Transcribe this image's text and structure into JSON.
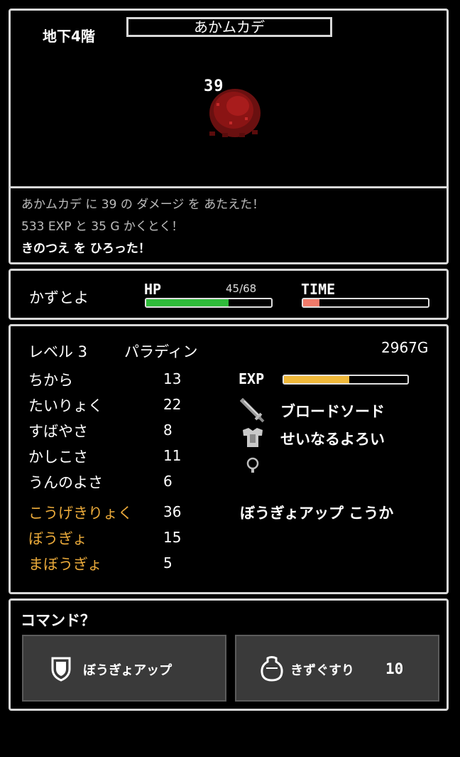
{
  "battle": {
    "floor": "地下4階",
    "enemy_name": "あかムカデ",
    "damage": "39"
  },
  "log": {
    "lines": [
      "あかムカデ に 39 の ダメージ を あたえた！",
      "533 EXP と 35 G かくとく！",
      "きのつえ を ひろった！"
    ]
  },
  "hero": {
    "name": "かずとよ",
    "hp_label": "HP",
    "hp_text": "45/68",
    "hp_fraction": 0.66,
    "time_label": "TIME",
    "time_fraction": 0.13
  },
  "stats": {
    "level": "レベル 3",
    "class": "パラディン",
    "gold": "2967G",
    "exp_label": "EXP",
    "exp_fraction": 0.53,
    "base": [
      {
        "name": "ちから",
        "value": "13"
      },
      {
        "name": "たいりょく",
        "value": "22"
      },
      {
        "name": "すばやさ",
        "value": "8"
      },
      {
        "name": "かしこさ",
        "value": "11"
      },
      {
        "name": "うんのよさ",
        "value": "6"
      }
    ],
    "derived": [
      {
        "name": "こうげきりょく",
        "value": "36"
      },
      {
        "name": "ぼうぎょ",
        "value": "15"
      },
      {
        "name": "まぼうぎょ",
        "value": "5"
      }
    ],
    "weapon": "ブロードソード",
    "armor": "せいなるよろい",
    "accessory": "",
    "effect": "ぼうぎょアップ こうか"
  },
  "command": {
    "prompt": "コマンド？",
    "defend_label": "ぼうぎょアップ",
    "potion_label": "きずぐすり",
    "potion_count": "10"
  },
  "colors": {
    "hp": "#2fbb3a",
    "time": "#f07a6a",
    "exp": "#f0b93a",
    "derived_stat": "#e9a93a"
  }
}
